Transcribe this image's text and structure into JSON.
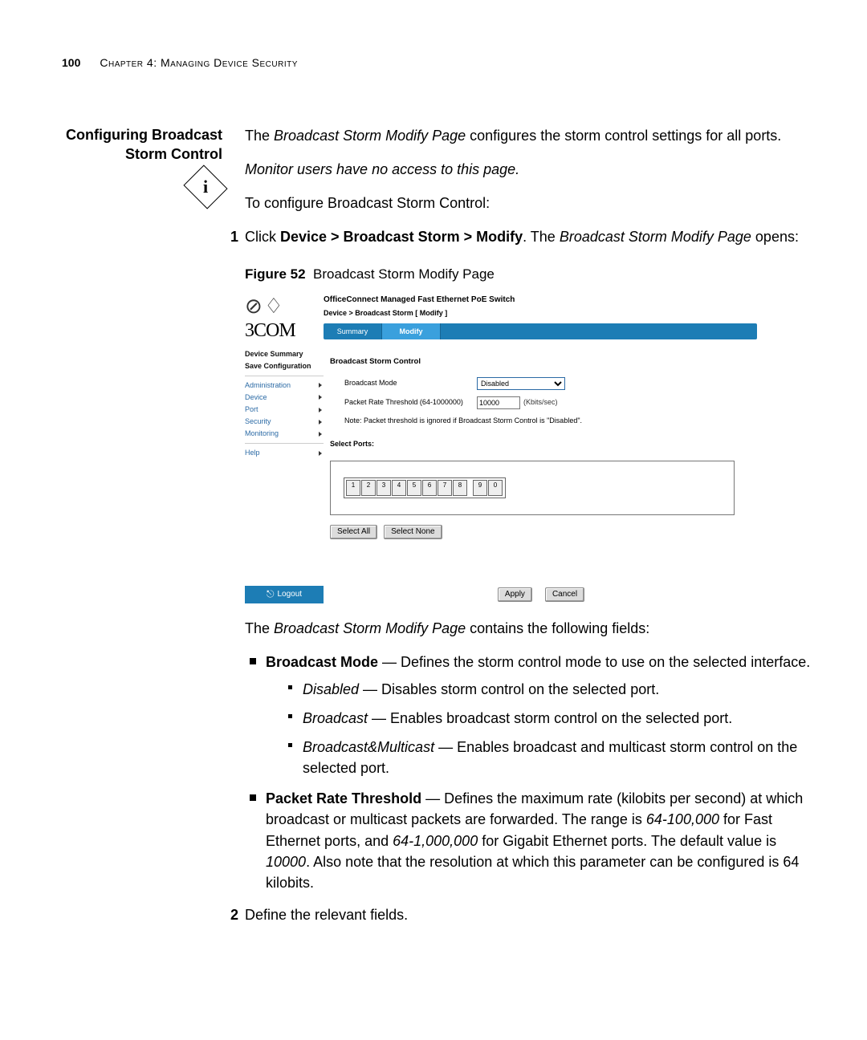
{
  "header": {
    "page_number": "100",
    "chapter_label": "Chapter 4: Managing Device Security"
  },
  "side_heading": "Configuring Broadcast Storm Control",
  "intro": {
    "p1_pre": "The ",
    "p1_em": "Broadcast Storm Modify Page",
    "p1_post": " configures the storm control settings for all ports.",
    "monitor_note": "Monitor users have no access to this page.",
    "howto": "To configure Broadcast Storm Control:"
  },
  "steps": {
    "s1_num": "1",
    "s1_a": "Click ",
    "s1_b": "Device > Broadcast Storm > Modify",
    "s1_c": ". The ",
    "s1_d": "Broadcast Storm Modify Page",
    "s1_e": " opens:",
    "s2_num": "2",
    "s2_text": "Define the relevant fields."
  },
  "figure": {
    "label": "Figure 52",
    "title": "Broadcast Storm Modify Page"
  },
  "screenshot": {
    "logo": "3COM",
    "product_title": "OfficeConnect Managed Fast Ethernet PoE Switch",
    "breadcrumb": "Device > Broadcast Storm [ Modify ]",
    "tab_summary": "Summary",
    "tab_modify": "Modify",
    "nav": {
      "dev_summary": "Device Summary",
      "save_config": "Save Configuration",
      "admin": "Administration",
      "device": "Device",
      "port": "Port",
      "security": "Security",
      "monitoring": "Monitoring",
      "help": "Help"
    },
    "panel": {
      "section": "Broadcast Storm Control",
      "mode_label": "Broadcast Mode",
      "mode_value": "Disabled",
      "rate_label": "Packet Rate Threshold (64-1000000)",
      "rate_value": "10000",
      "rate_unit": "(Kbits/sec)",
      "note": "Note: Packet threshold is ignored if Broadcast Storm Control is \"Disabled\".",
      "ports_title": "Select Ports:",
      "ports": [
        "1",
        "2",
        "3",
        "4",
        "5",
        "6",
        "7",
        "8",
        "9",
        "0"
      ],
      "select_all": "Select All",
      "select_none": "Select None"
    },
    "footer": {
      "logout": "Logout",
      "apply": "Apply",
      "cancel": "Cancel"
    }
  },
  "after_fig": {
    "lead_a": "The ",
    "lead_b": "Broadcast Storm Modify Page",
    "lead_c": " contains the following fields:",
    "bm_title": "Broadcast Mode",
    "bm_desc": " — Defines the storm control mode to use on the selected interface.",
    "bm_sub_disabled_a": "Disabled",
    "bm_sub_disabled_b": " — Disables storm control on the selected port.",
    "bm_sub_broadcast_a": "Broadcast",
    "bm_sub_broadcast_b": " — Enables broadcast storm control on the selected port.",
    "bm_sub_bm_a": "Broadcast&Multicast",
    "bm_sub_bm_b": " — Enables broadcast and multicast storm control on the selected port.",
    "prt_title": "Packet Rate Threshold",
    "prt_a": " — Defines the maximum rate (kilobits per second) at which broadcast or multicast packets are forwarded. The range is ",
    "prt_b": "64-100,000",
    "prt_c": " for Fast Ethernet ports, and ",
    "prt_d": "64-1,000,000",
    "prt_e": " for Gigabit Ethernet ports. The default value is ",
    "prt_f": "10000",
    "prt_g": ". Also note that the resolution at which this parameter can be configured is 64 kilobits."
  }
}
